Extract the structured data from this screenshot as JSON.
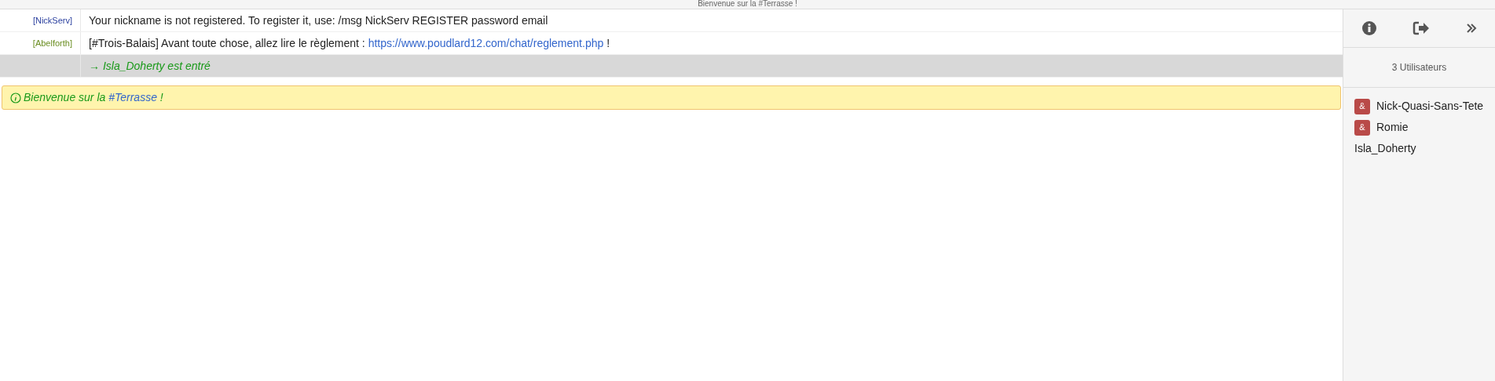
{
  "topic": "Bienvenue sur la #Terrasse !",
  "messages": [
    {
      "kind": "message",
      "nick": "[NickServ]",
      "color": "#2a3f9e",
      "parts": [
        {
          "text": "Your nickname is not registered. To register it, use: /msg NickServ REGISTER password email"
        }
      ]
    },
    {
      "kind": "message",
      "nick": "[Abelforth]",
      "color": "#6b8e23",
      "parts": [
        {
          "text": "[#Trois-Balais] Avant toute chose, allez lire le règlement : "
        },
        {
          "link": "https://www.poudlard12.com/chat/reglement.php"
        },
        {
          "text": " !"
        }
      ]
    },
    {
      "kind": "join",
      "text": "→ Isla_Doherty est entré"
    }
  ],
  "notice": {
    "before": "Bienvenue sur la ",
    "channel": "#Terrasse",
    "after": " !"
  },
  "sidebar": {
    "user_count": "3 Utilisateurs",
    "users": [
      {
        "mode": "&",
        "name": "Nick-Quasi-Sans-Tete"
      },
      {
        "mode": "&",
        "name": "Romie"
      },
      {
        "name": "Isla_Doherty"
      }
    ]
  }
}
